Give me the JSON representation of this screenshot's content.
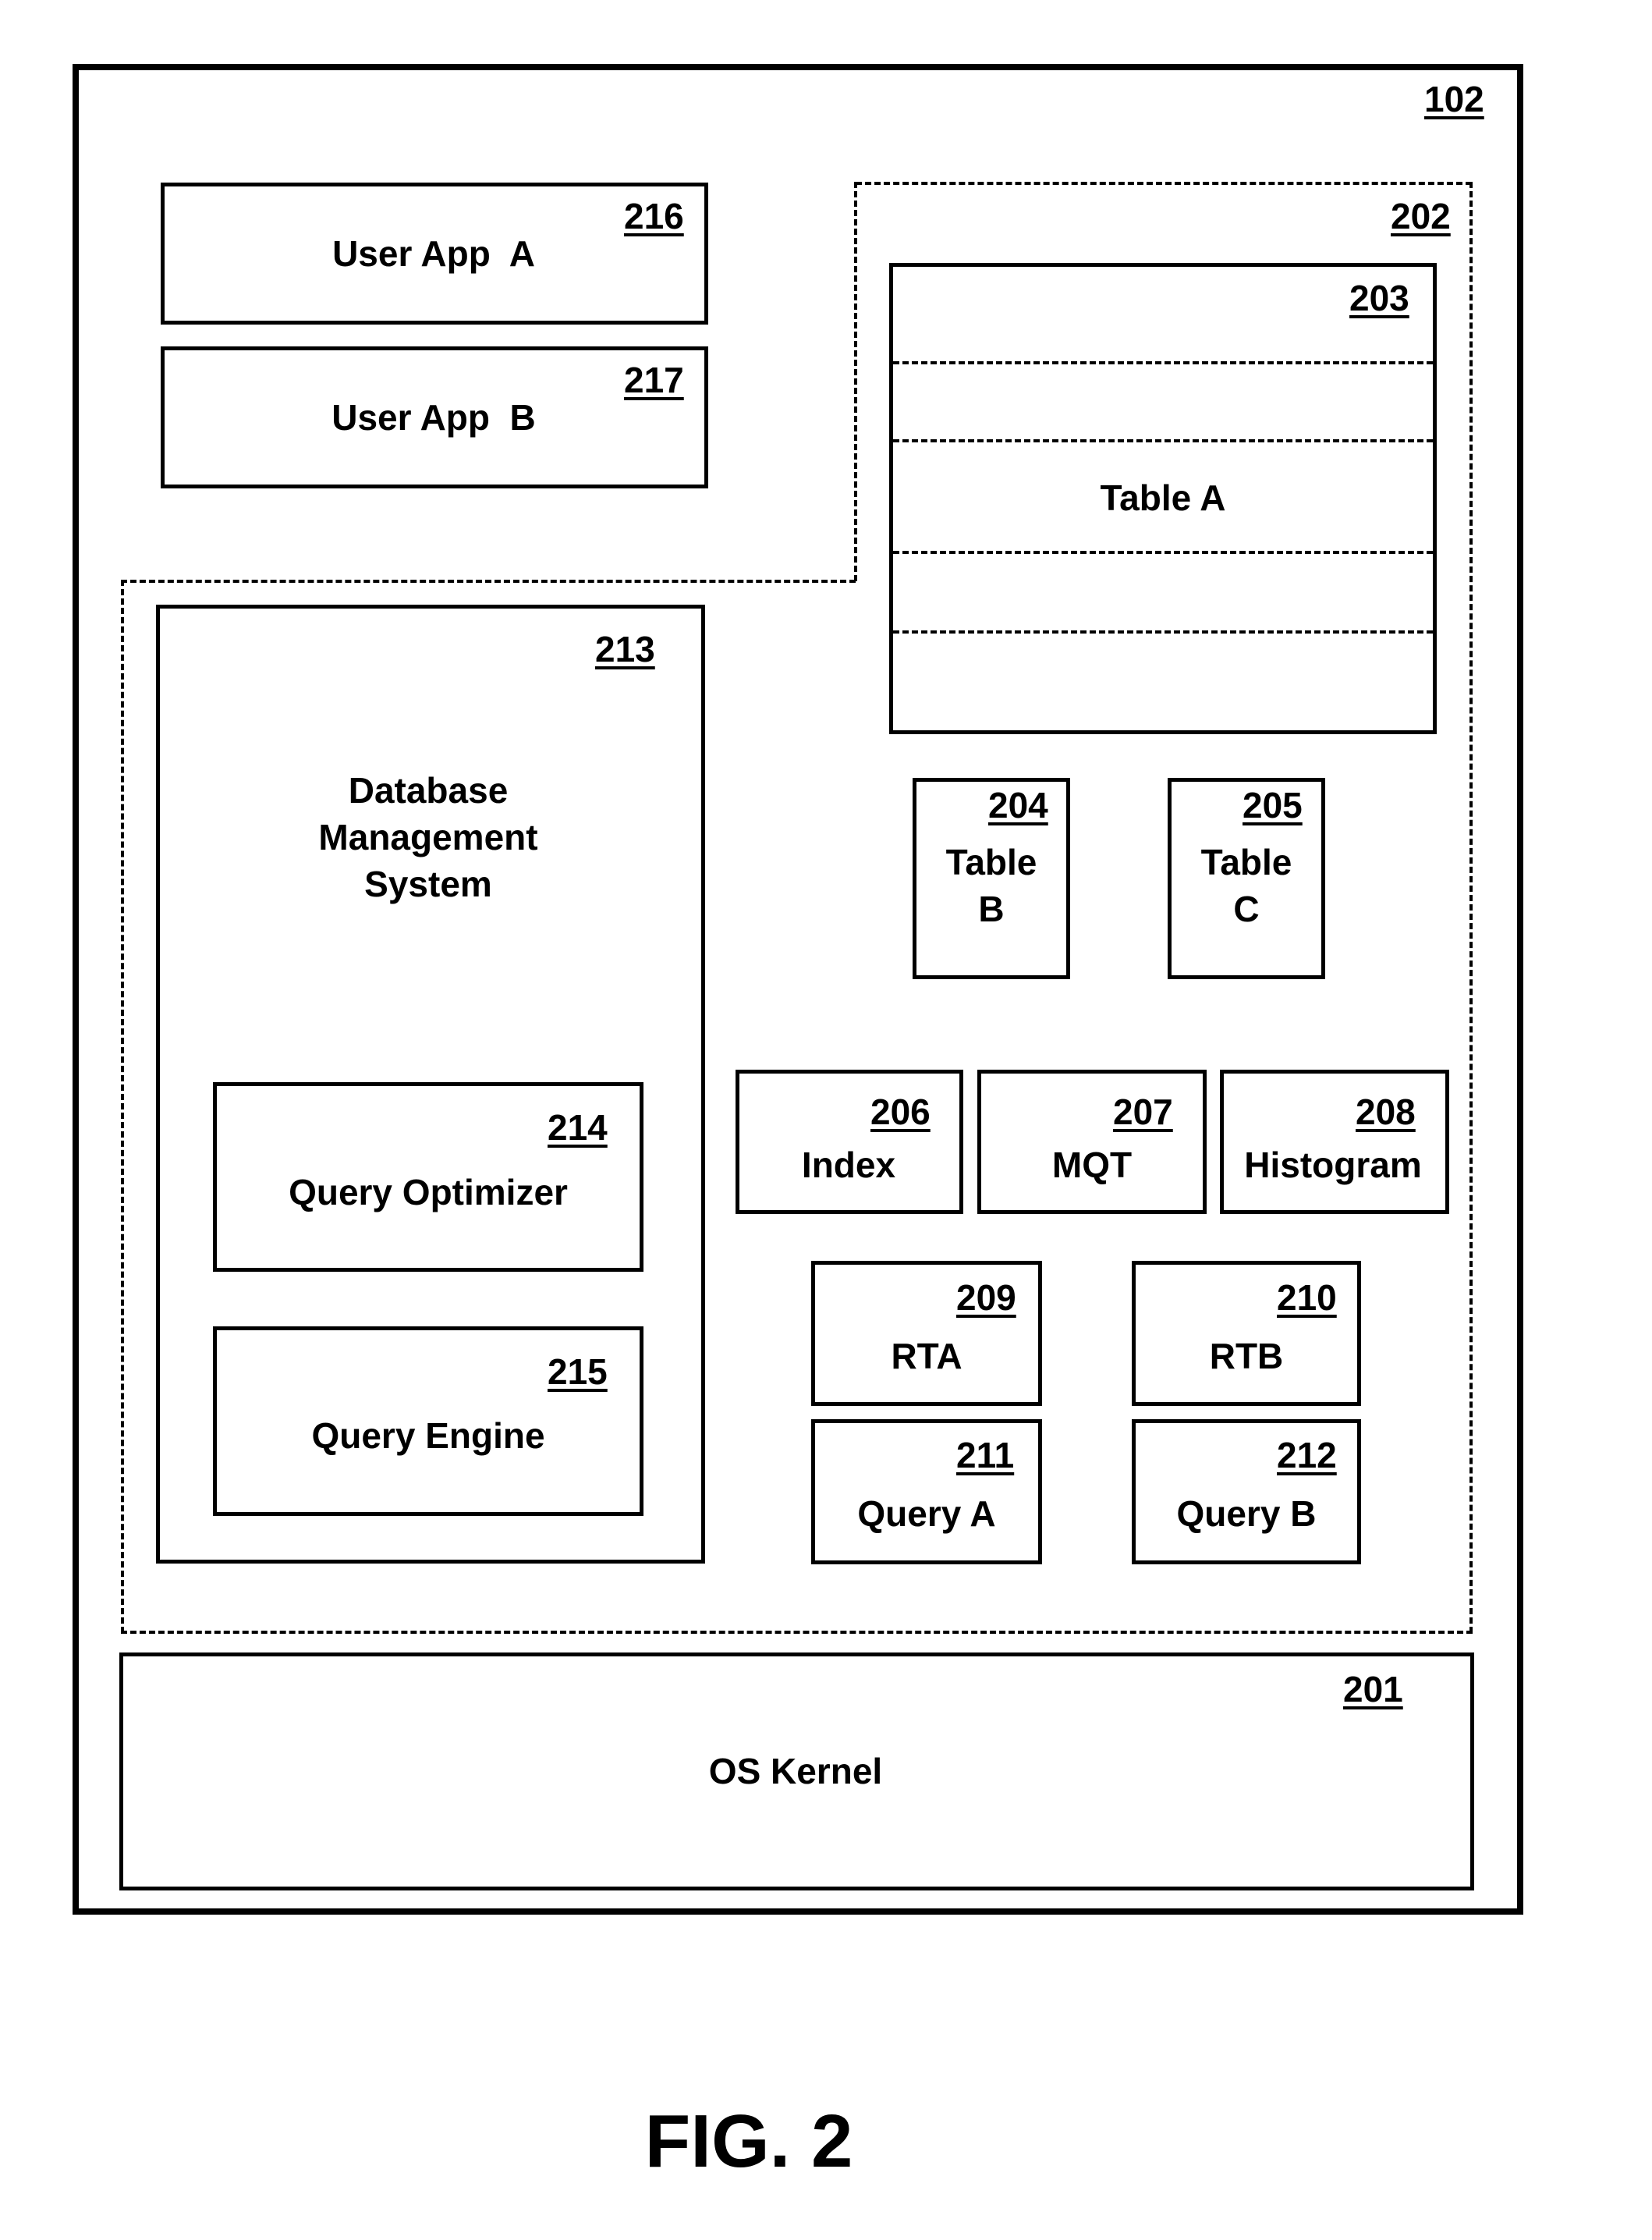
{
  "figure": {
    "caption": "FIG. 2",
    "system_ref": "102",
    "components": {
      "user_app_a": {
        "label": "User App  A",
        "ref": "216"
      },
      "user_app_b": {
        "label": "User App  B",
        "ref": "217"
      },
      "memory_region": {
        "ref": "202"
      },
      "table_a": {
        "label": "Table A",
        "ref": "203"
      },
      "table_b": {
        "label_line1": "Table",
        "label_line2": "B",
        "ref": "204"
      },
      "table_c": {
        "label_line1": "Table",
        "label_line2": "C",
        "ref": "205"
      },
      "index": {
        "label": "Index",
        "ref": "206"
      },
      "mqt": {
        "label": "MQT",
        "ref": "207"
      },
      "histogram": {
        "label": "Histogram",
        "ref": "208"
      },
      "rta": {
        "label": "RTA",
        "ref": "209"
      },
      "rtb": {
        "label": "RTB",
        "ref": "210"
      },
      "query_a": {
        "label": "Query A",
        "ref": "211"
      },
      "query_b": {
        "label": "Query B",
        "ref": "212"
      },
      "dbms": {
        "label_line1": "Database",
        "label_line2": "Management",
        "label_line3": "System",
        "ref": "213"
      },
      "query_optimizer": {
        "label": "Query Optimizer",
        "ref": "214"
      },
      "query_engine": {
        "label": "Query Engine",
        "ref": "215"
      },
      "os_kernel": {
        "label": "OS Kernel",
        "ref": "201"
      }
    }
  }
}
